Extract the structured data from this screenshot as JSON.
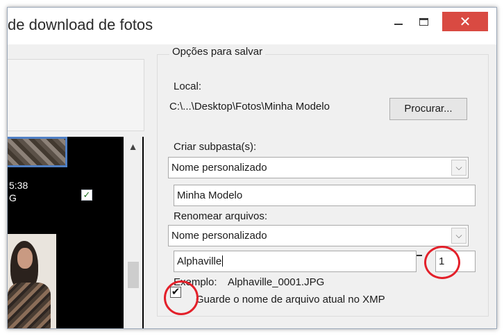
{
  "window": {
    "title": "de download de fotos",
    "controls": {
      "minimize_icon": "minimize-icon",
      "maximize_icon": "maximize-icon",
      "close_glyph": "✕"
    }
  },
  "thumbnails": {
    "time_text": "5:38",
    "type_text": "G",
    "checkbox_glyph": "✓"
  },
  "scrollbar": {
    "up_glyph": "▲"
  },
  "save_options": {
    "legend": "Opções para salvar",
    "local_label": "Local:",
    "local_path": "C:\\...\\Desktop\\Fotos\\Minha Modelo",
    "browse_button": "Procurar...",
    "subfolder_label": "Criar subpasta(s):",
    "subfolder_select": "Nome personalizado",
    "subfolder_name": "Minha Modelo",
    "rename_label": "Renomear arquivos:",
    "rename_select": "Nome personalizado",
    "rename_name": "Alphaville",
    "rename_start": "1",
    "example_label": "Exemplo:",
    "example_value": "Alphaville_0001.JPG",
    "xmp_checkbox_glyph": "✔",
    "xmp_label": "Guarde o nome de arquivo atual no XMP",
    "dropdown_glyph": "⌵"
  },
  "colors": {
    "highlight_ring": "#e3202a",
    "close_button": "#d94a42",
    "selection_border": "#4f7fc4"
  }
}
